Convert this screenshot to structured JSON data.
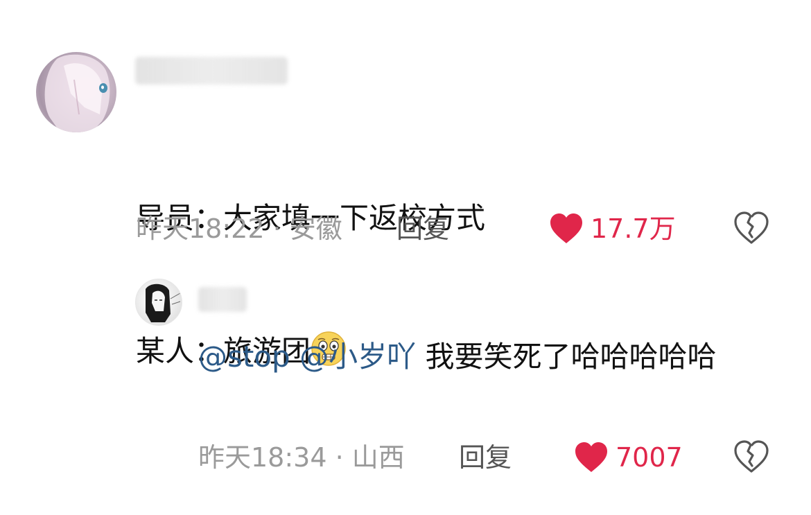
{
  "comments": [
    {
      "avatar_icon": "anime-girl-avatar-icon",
      "line1": "导员：大家填一下返校方式",
      "line2_text": "某人：旅游团",
      "line2_emoji": "pleading-face-emoji-icon",
      "time_location": "昨天18:22 · 安徽",
      "reply_label": "回复",
      "likes": "17.7万"
    },
    {
      "avatar_icon": "sketch-girl-avatar-icon",
      "mention_1": "@stop",
      "mention_2": "@小岁吖",
      "text": "我要笑死了哈哈哈哈哈",
      "time_location": "昨天18:34 · 山西",
      "reply_label": "回复",
      "likes": "7007"
    }
  ],
  "colors": {
    "like_red": "#e0264a",
    "mention_blue": "#2c5a88",
    "meta_gray": "#9a9a9a"
  }
}
